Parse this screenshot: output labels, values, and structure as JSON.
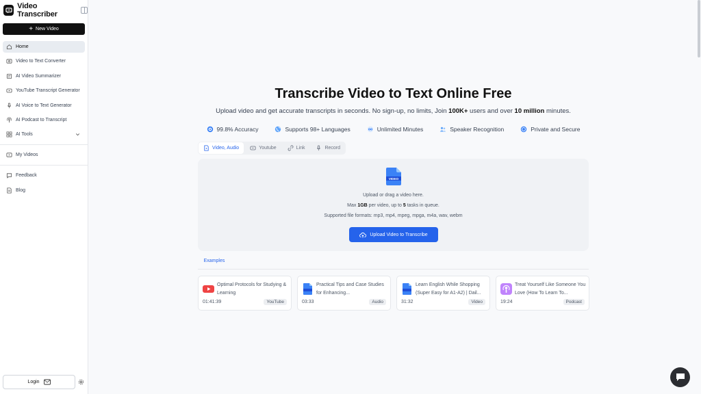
{
  "brand": {
    "title": "Video Transcriber",
    "logo_icon": "transcriber-logo-icon"
  },
  "sidebar": {
    "new_video_label": "New Video",
    "items": [
      {
        "label": "Home",
        "icon": "home-icon",
        "active": true
      },
      {
        "label": "Video to Text Converter",
        "icon": "video-icon"
      },
      {
        "label": "AI Video Summarizer",
        "icon": "summary-icon"
      },
      {
        "label": "YouTube Transcript Generator",
        "icon": "youtube-icon"
      },
      {
        "label": "AI Voice to Text Generator",
        "icon": "mic-icon"
      },
      {
        "label": "AI Podcast to Transcript",
        "icon": "podcast-icon"
      },
      {
        "label": "AI Tools",
        "icon": "grid-icon"
      }
    ],
    "secondary": [
      {
        "label": "My Videos",
        "icon": "folder-icon"
      }
    ],
    "tertiary": [
      {
        "label": "Feedback",
        "icon": "feedback-icon"
      },
      {
        "label": "Blog",
        "icon": "blog-icon"
      }
    ],
    "login_label": "Login"
  },
  "hero": {
    "title": "Transcribe Video to Text Online Free",
    "subtitle_pre": "Upload video and get accurate transcripts in seconds. No sign-up, no limits, Join ",
    "subtitle_users": "100K+",
    "subtitle_mid": " users and over ",
    "subtitle_minutes": "10 million",
    "subtitle_post": " minutes."
  },
  "features": [
    {
      "label": "99.8% Accuracy",
      "icon": "target-icon"
    },
    {
      "label": "Supports 98+ Languages",
      "icon": "globe-icon"
    },
    {
      "label": "Unlimited Minutes",
      "icon": "infinity-icon"
    },
    {
      "label": "Speaker Recognition",
      "icon": "users-icon"
    },
    {
      "label": "Private and Secure",
      "icon": "shield-icon"
    }
  ],
  "tabs": [
    {
      "label": "Video, Audio",
      "icon": "media-icon",
      "active": true
    },
    {
      "label": "Youtube",
      "icon": "youtube-icon"
    },
    {
      "label": "Link",
      "icon": "link-icon"
    },
    {
      "label": "Record",
      "icon": "mic-icon"
    }
  ],
  "upload": {
    "file_badge": "VIDEO",
    "line1": "Upload or drag a video here.",
    "line2_pre": "Max ",
    "line2_size": "1GB",
    "line2_mid": " per video, up to ",
    "line2_tasks": "5",
    "line2_post": " tasks in queue.",
    "line3": "Supported file formats: mp3, mp4, mpeg, mpga, m4a, wav, webm",
    "button_label": "Upload Video to Transcribe"
  },
  "examples": {
    "tab_label": "Examples",
    "items": [
      {
        "title": "Optimal Protocols for Studying & Learning",
        "duration": "01:41:39",
        "source": "YouTube",
        "icon": "youtube-icon"
      },
      {
        "title": "Practical Tips and Case Studies for Enhancing...",
        "duration": "03:33",
        "source": "Audio",
        "icon": "audio-file-icon"
      },
      {
        "title": "Learn English While Shopping (Super Easy for A1-A2) | Dail...",
        "duration": "31:32",
        "source": "Video",
        "icon": "video-file-icon"
      },
      {
        "title": "Treat Yourself Like Someone You Love (How To Learn To...",
        "duration": "19:24",
        "source": "Podcast",
        "icon": "podcast-icon"
      }
    ]
  },
  "colors": {
    "accent": "#2563eb",
    "dark": "#111111"
  }
}
